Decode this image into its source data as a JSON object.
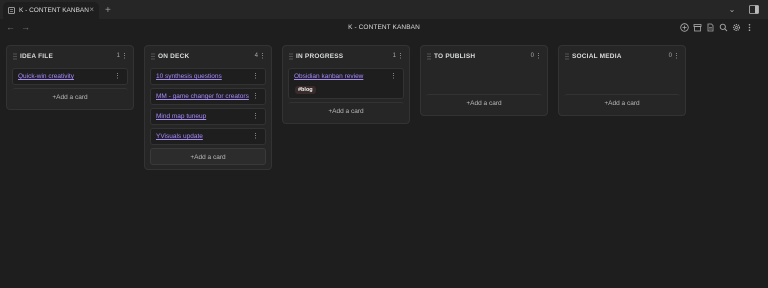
{
  "tab": {
    "title": "K - CONTENT KANBAN",
    "close": "×",
    "new": "+"
  },
  "view": {
    "title": "K - CONTENT KANBAN",
    "back": "←",
    "forward": "→"
  },
  "window": {
    "chevron": "⌄"
  },
  "colors": {
    "accent": "#a88bfa",
    "background": "#1e1e1e",
    "lane": "#262626"
  },
  "icons": [
    "document-icon",
    "sidebar-toggle-icon",
    "archive-icon",
    "file-icon",
    "search-icon",
    "settings-icon",
    "more-vertical-icon",
    "plus-circle-icon"
  ],
  "lanes": [
    {
      "title": "IDEA FILE",
      "count": "1",
      "cards": [
        {
          "title": "Quick-win creativity"
        }
      ],
      "add": "+Add a card"
    },
    {
      "title": "ON DECK",
      "count": "4",
      "cards": [
        {
          "title": "10 synthesis questions"
        },
        {
          "title": "MM - game changer for creators"
        },
        {
          "title": "Mind map tuneup"
        },
        {
          "title": "YVisuals update"
        }
      ],
      "add": "+Add a card"
    },
    {
      "title": "IN PROGRESS",
      "count": "1",
      "cards": [
        {
          "title": "Obsidian kanban review",
          "tag": "#blog"
        }
      ],
      "add": "+Add a card"
    },
    {
      "title": "TO PUBLISH",
      "count": "0",
      "cards": [],
      "add": "+Add a card"
    },
    {
      "title": "SOCIAL MEDIA",
      "count": "0",
      "cards": [],
      "add": "+Add a card"
    }
  ]
}
